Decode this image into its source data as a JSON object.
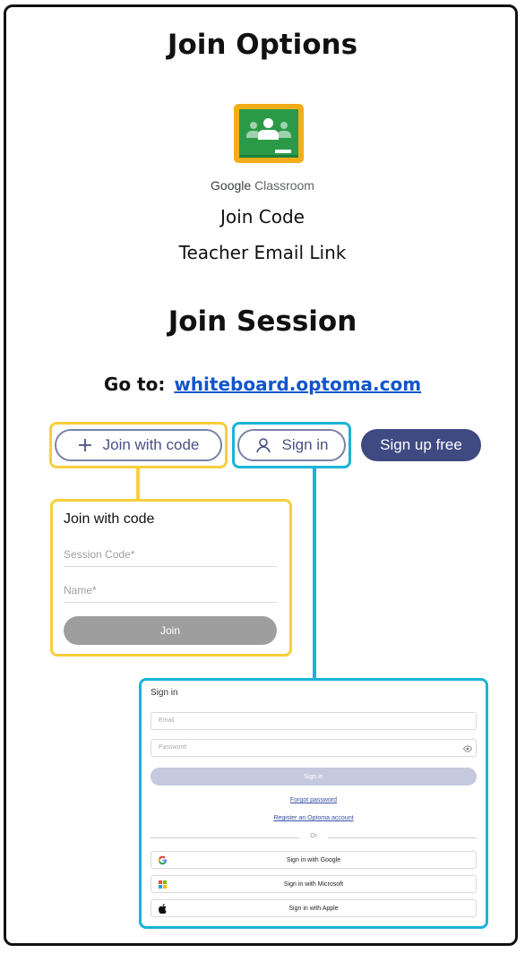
{
  "heading_options": "Join Options",
  "google_classroom": {
    "google": "Google",
    "classroom": "Classroom"
  },
  "option_join_code": "Join Code",
  "option_email_link": "Teacher Email Link",
  "heading_session": "Join Session",
  "goto": {
    "label": "Go to:",
    "url": "whiteboard.optoma.com"
  },
  "toolbar": {
    "join_with_code": "Join with code",
    "sign_in": "Sign in",
    "sign_up_free": "Sign up free"
  },
  "join_card": {
    "title": "Join with code",
    "session_code_placeholder": "Session Code*",
    "name_placeholder": "Name*",
    "join_button": "Join"
  },
  "signin_card": {
    "title": "Sign in",
    "email_placeholder": "Email",
    "password_placeholder": "Password",
    "signin_button": "Sign in",
    "forgot_password": "Forgot password",
    "register": "Register an Optoma account",
    "or": "Or",
    "google": "Sign in with Google",
    "microsoft": "Sign in with Microsoft",
    "apple": "Sign in with Apple"
  },
  "colors": {
    "highlight_yellow": "#f7cf3c",
    "highlight_blue": "#1ab4d6",
    "brand_navy": "#3f4a82",
    "link_blue": "#1155cc",
    "classroom_green": "#2a9a49",
    "classroom_yellow": "#f3ad18"
  }
}
